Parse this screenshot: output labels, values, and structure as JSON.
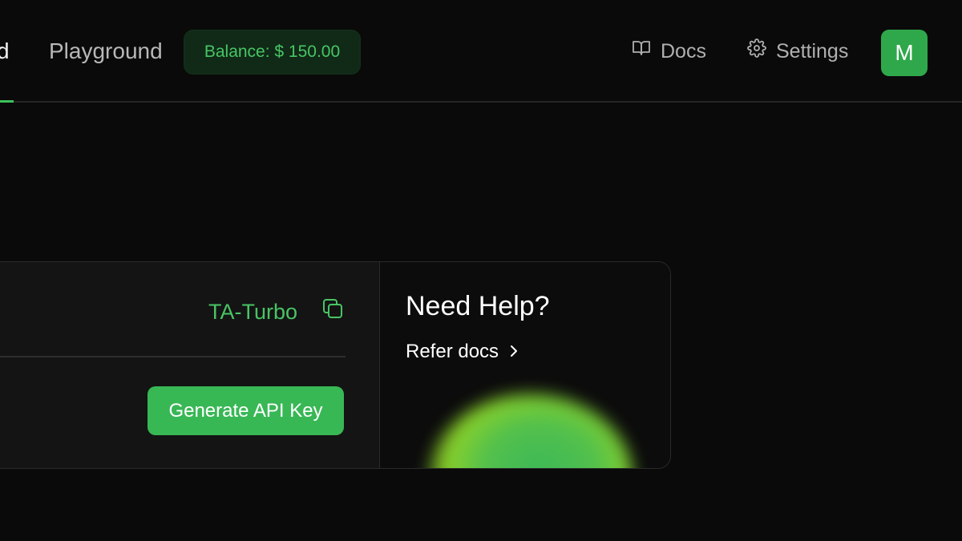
{
  "header": {
    "active_tab_label": "d",
    "playground_label": "Playground",
    "balance_text": "Balance: $ 150.00",
    "docs_label": "Docs",
    "settings_label": "Settings",
    "avatar_initial": "M"
  },
  "card": {
    "model_name": "TA-Turbo",
    "generate_button_label": "Generate API Key",
    "help_title": "Need Help?",
    "refer_link_label": "Refer docs"
  },
  "colors": {
    "accent": "#3cc15a",
    "background": "#0a0a0a"
  },
  "icons": {
    "docs": "book-open-icon",
    "settings": "gear-icon",
    "copy": "copy-icon",
    "refer": "chevron-right-icon"
  }
}
